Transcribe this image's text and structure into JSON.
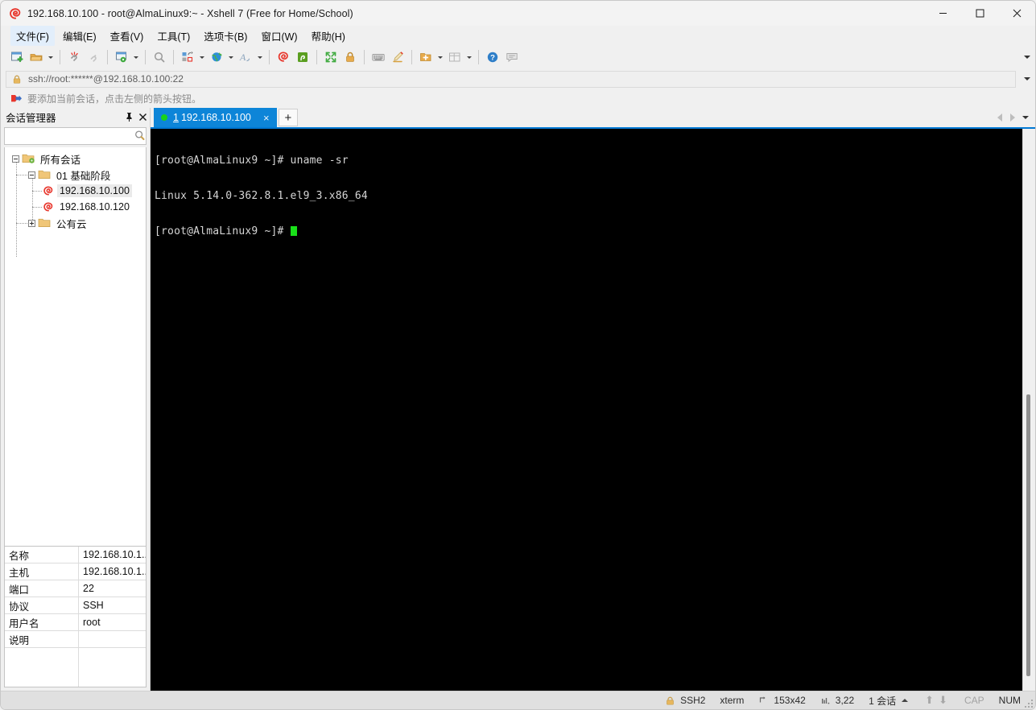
{
  "window": {
    "title": "192.168.10.100 - root@AlmaLinux9:~ - Xshell 7 (Free for Home/School)",
    "app_icon": "xshell-spiral-icon",
    "minimize_label": "─",
    "maximize_label": "□",
    "close_label": "✕"
  },
  "menu": {
    "items": [
      {
        "label": "文件(F)",
        "name": "menu-file",
        "active": true
      },
      {
        "label": "编辑(E)",
        "name": "menu-edit",
        "active": false
      },
      {
        "label": "查看(V)",
        "name": "menu-view",
        "active": false
      },
      {
        "label": "工具(T)",
        "name": "menu-tools",
        "active": false
      },
      {
        "label": "选项卡(B)",
        "name": "menu-tabs",
        "active": false
      },
      {
        "label": "窗口(W)",
        "name": "menu-window",
        "active": false
      },
      {
        "label": "帮助(H)",
        "name": "menu-help",
        "active": false
      }
    ]
  },
  "toolbar": {
    "icons": [
      "new-session-icon",
      "open-folder-icon",
      "disconnect-icon",
      "link-icon",
      "session-properties-icon",
      "layout-icon",
      "globe-icon",
      "font-icon",
      "xshell-icon",
      "xftp-icon",
      "fullscreen-icon",
      "lock-icon",
      "keyboard-icon",
      "highlighter-icon",
      "new-folder-icon",
      "split-view-icon",
      "help-icon",
      "chat-icon"
    ],
    "overflow_label": "▼"
  },
  "address_bar": {
    "lock_icon": "lock-icon",
    "value": "ssh://root:******@192.168.10.100:22",
    "placeholder": "ssh://",
    "dropdown_label": "▼"
  },
  "notice": {
    "icon": "add-session-arrow-icon",
    "text": "要添加当前会话，点击左侧的箭头按钮。"
  },
  "sidebar": {
    "title": "会话管理器",
    "pin_label": "⚑",
    "close_label": "✕",
    "search": {
      "value": "",
      "placeholder": "",
      "icon": "search-icon"
    },
    "tree": [
      {
        "label": "所有会话",
        "icon": "all-sessions-folder-icon",
        "depth": 0,
        "expanded": true,
        "selected": false,
        "type": "folder"
      },
      {
        "label": "01 基础阶段",
        "icon": "folder-icon",
        "depth": 1,
        "expanded": true,
        "selected": false,
        "type": "folder"
      },
      {
        "label": "192.168.10.100",
        "icon": "xshell-session-icon",
        "depth": 2,
        "expanded": null,
        "selected": true,
        "type": "session"
      },
      {
        "label": "192.168.10.120",
        "icon": "xshell-session-icon",
        "depth": 2,
        "expanded": null,
        "selected": false,
        "type": "session"
      },
      {
        "label": "公有云",
        "icon": "folder-icon",
        "depth": 1,
        "expanded": false,
        "selected": false,
        "type": "folder"
      }
    ],
    "properties": [
      {
        "key": "名称",
        "value": "192.168.10.1..."
      },
      {
        "key": "主机",
        "value": "192.168.10.1..."
      },
      {
        "key": "端口",
        "value": "22"
      },
      {
        "key": "协议",
        "value": "SSH"
      },
      {
        "key": "用户名",
        "value": "root"
      },
      {
        "key": "说明",
        "value": ""
      },
      {
        "key": "",
        "value": ""
      }
    ]
  },
  "tabs": {
    "items": [
      {
        "number": "1",
        "label": "192.168.10.100",
        "active": true,
        "status": "connected",
        "close_label": "×"
      }
    ],
    "add_label": "+",
    "nav_prev": "◀",
    "nav_next": "▶",
    "nav_menu": "▼"
  },
  "terminal": {
    "lines": [
      "[root@AlmaLinux9 ~]# uname -sr",
      "Linux 5.14.0-362.8.1.el9_3.x86_64",
      "[root@AlmaLinux9 ~]# "
    ],
    "cursor_visible": true,
    "bg_color": "#000000",
    "fg_color": "#d6d6d6",
    "cursor_color": "#19e019"
  },
  "status_bar": {
    "protocol_icon": "lock-icon",
    "protocol": "SSH2",
    "term_type": "xterm",
    "size_icon": "resize-icon",
    "size": "153x42",
    "cursor_icon": "cursor-pos-icon",
    "cursor_pos": "3,22",
    "sessions": "1 会话",
    "sessions_caret": "▲",
    "upload_icon": "arrow-up-icon",
    "download_icon": "arrow-down-icon",
    "caps": "CAP",
    "num": "NUM"
  },
  "colors": {
    "accent": "#0078d4",
    "tab_active": "#0d85d8",
    "terminal_bg": "#000000",
    "connected_dot": "#19d219",
    "chrome": "#f0f0f0",
    "status_bg": "#e0e0e0"
  }
}
